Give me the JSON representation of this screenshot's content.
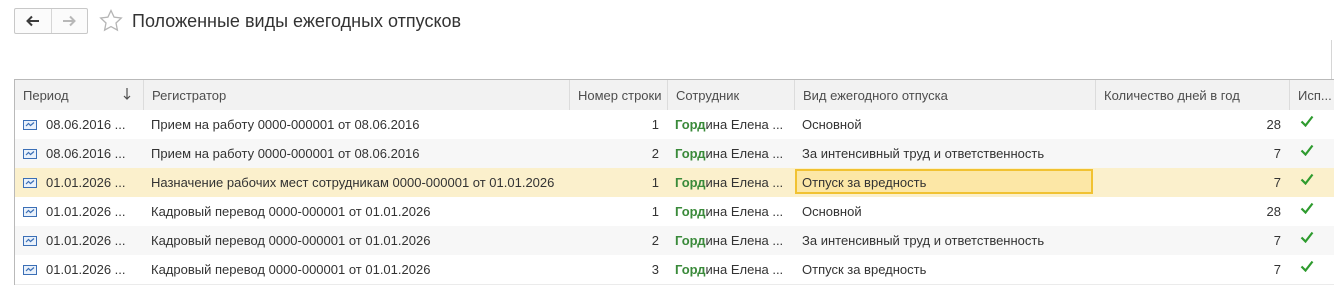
{
  "window": {
    "title": "Положенные виды ежегодных отпусков"
  },
  "icons": {
    "back": "arrow-left-icon",
    "forward": "arrow-right-icon",
    "favorite": "star-outline-icon",
    "row": "register-record-icon",
    "check": "checkmark-icon"
  },
  "colors": {
    "selected_row": "#fbf0cc",
    "active_cell_border": "#f1c232",
    "employee_highlight": "#3a8a3a",
    "check": "#2e9b2e"
  },
  "table": {
    "columns": [
      "Период",
      "Регистратор",
      "Номер строки",
      "Сотрудник",
      "Вид ежегодного отпуска",
      "Количество дней в год",
      "Исп..."
    ],
    "sort": "↓",
    "rows": [
      {
        "period": "08.06.2016 ...",
        "registrar": "Прием на работу 0000-000001 от 08.06.2016",
        "line": "1",
        "emp_hl": "Горд",
        "emp_rest": "ина Елена ...",
        "kind": "Основной",
        "days": "28"
      },
      {
        "period": "08.06.2016 ...",
        "registrar": "Прием на работу 0000-000001 от 08.06.2016",
        "line": "2",
        "emp_hl": "Горд",
        "emp_rest": "ина Елена ...",
        "kind": "За интенсивный труд и ответственность",
        "days": "7"
      },
      {
        "period": "01.01.2026 ...",
        "registrar": "Назначение рабочих мест сотрудникам 0000-000001 от 01.01.2026",
        "line": "1",
        "emp_hl": "Горд",
        "emp_rest": "ина Елена ...",
        "kind": "Отпуск за вредность",
        "days": "7"
      },
      {
        "period": "01.01.2026 ...",
        "registrar": "Кадровый перевод 0000-000001 от 01.01.2026",
        "line": "1",
        "emp_hl": "Горд",
        "emp_rest": "ина Елена ...",
        "kind": "Основной",
        "days": "28"
      },
      {
        "period": "01.01.2026 ...",
        "registrar": "Кадровый перевод 0000-000001 от 01.01.2026",
        "line": "2",
        "emp_hl": "Горд",
        "emp_rest": "ина Елена ...",
        "kind": "За интенсивный труд и ответственность",
        "days": "7"
      },
      {
        "period": "01.01.2026 ...",
        "registrar": "Кадровый перевод 0000-000001 от 01.01.2026",
        "line": "3",
        "emp_hl": "Горд",
        "emp_rest": "ина Елена ...",
        "kind": "Отпуск за вредность",
        "days": "7"
      }
    ]
  }
}
